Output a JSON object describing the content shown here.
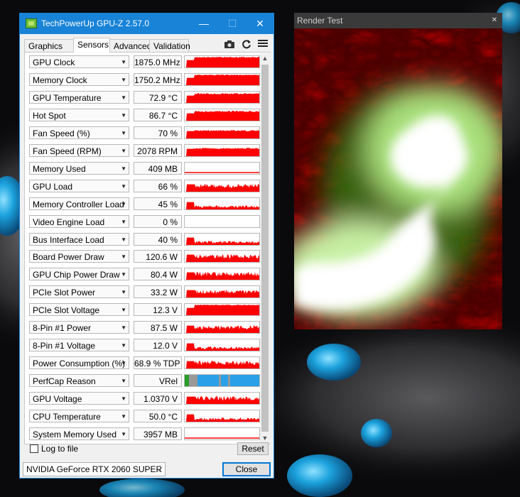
{
  "gpuz": {
    "title": "TechPowerUp GPU-Z 2.57.0",
    "tabs": [
      "Graphics Card",
      "Sensors",
      "Advanced",
      "Validation"
    ],
    "active_tab": "Sensors",
    "sensors": [
      {
        "name": "GPU Clock",
        "value": "1875.0 MHz",
        "graph": "full"
      },
      {
        "name": "Memory Clock",
        "value": "1750.2 MHz",
        "graph": "full"
      },
      {
        "name": "GPU Temperature",
        "value": "72.9 °C",
        "graph": "high"
      },
      {
        "name": "Hot Spot",
        "value": "86.7 °C",
        "graph": "high"
      },
      {
        "name": "Fan Speed (%)",
        "value": "70 %",
        "graph": "mid-high"
      },
      {
        "name": "Fan Speed (RPM)",
        "value": "2078 RPM",
        "graph": "mid-high"
      },
      {
        "name": "Memory Used",
        "value": "409 MB",
        "graph": "line-low"
      },
      {
        "name": "GPU Load",
        "value": "66 %",
        "graph": "spiky"
      },
      {
        "name": "Memory Controller Load",
        "value": "45 %",
        "graph": "spiky-low"
      },
      {
        "name": "Video Engine Load",
        "value": "0 %",
        "graph": "empty"
      },
      {
        "name": "Bus Interface Load",
        "value": "40 %",
        "graph": "spiky-low"
      },
      {
        "name": "Board Power Draw",
        "value": "120.6 W",
        "graph": "spiky"
      },
      {
        "name": "GPU Chip Power Draw",
        "value": "80.4 W",
        "graph": "spiky"
      },
      {
        "name": "PCIe Slot Power",
        "value": "33.2 W",
        "graph": "spiky"
      },
      {
        "name": "PCIe Slot Voltage",
        "value": "12.3 V",
        "graph": "full"
      },
      {
        "name": "8-Pin #1 Power",
        "value": "87.5 W",
        "graph": "spiky"
      },
      {
        "name": "8-Pin #1 Voltage",
        "value": "12.0 V",
        "graph": "spiky-low"
      },
      {
        "name": "Power Consumption (%)",
        "value": "68.9 % TDP",
        "graph": "spiky"
      },
      {
        "name": "PerfCap Reason",
        "value": "VRel",
        "graph": "perfcap"
      },
      {
        "name": "GPU Voltage",
        "value": "1.0370 V",
        "graph": "spiky"
      },
      {
        "name": "CPU Temperature",
        "value": "50.0 °C",
        "graph": "spiky-low"
      },
      {
        "name": "System Memory Used",
        "value": "3957 MB",
        "graph": "line-low"
      }
    ],
    "log_to_file_label": "Log to file",
    "log_to_file_checked": false,
    "reset_label": "Reset",
    "gpu_select": "NVIDIA GeForce RTX 2060 SUPER",
    "close_label": "Close",
    "accent_color": "#1883d7",
    "graph_color": "#ff0000"
  },
  "render_test": {
    "title": "Render Test"
  }
}
